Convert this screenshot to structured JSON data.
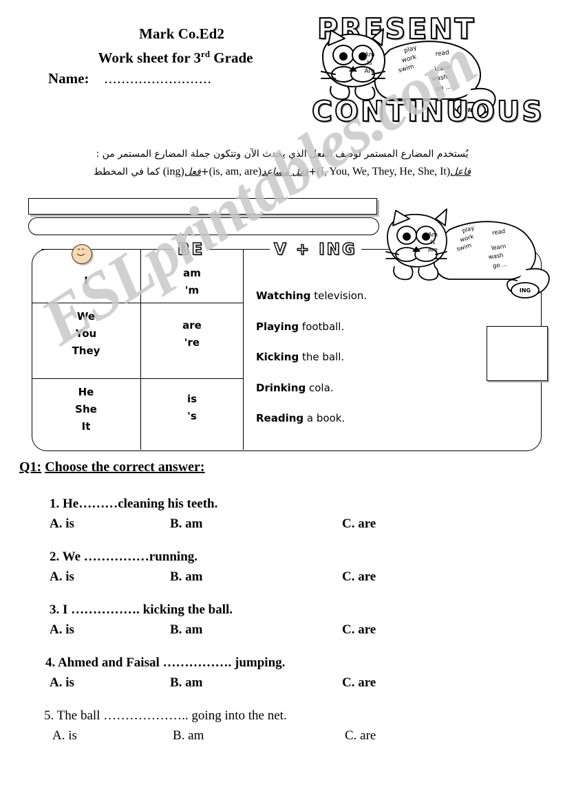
{
  "header": {
    "school": "Mark Co.Ed2",
    "worksheet_line_pre": "Work sheet for 3",
    "worksheet_line_sup": "rd",
    "worksheet_line_post": " Grade",
    "name_label": "Name:",
    "name_dots": "........................."
  },
  "title_art": {
    "word_top": "PRESENT",
    "word_bottom": "CONTINUOUS",
    "cat_head_words": "Am\nIs\nAre",
    "cat_body_words_1": "play",
    "cat_body_words_2": "work",
    "cat_body_words_3": "read",
    "cat_body_words_4": "swim",
    "cat_body_words_5": "learn",
    "cat_body_words_6": "wash",
    "cat_body_words_7": "go ...",
    "cat_tail_word": "ING"
  },
  "arabic": {
    "line1": "يُستخدم المضارع المستمر لوصف الفعل الذي يحدث الآن وتتكون جملة المضارع المستمر من :",
    "line2_a": "فاعل",
    "line2_en1": "(I, You, We, They, He, She, It)",
    "line2_b": "فعل مساعد",
    "line2_en2": "(is, am, are)",
    "line2_c": "فعل",
    "line2_en3": "(ing)",
    "line2_d": "كما في المخطط"
  },
  "table": {
    "head_be": "BE",
    "head_ving": "V + ING",
    "rows": [
      {
        "pronoun": "I",
        "be": "am\n'm"
      },
      {
        "pronoun": "We\nYou\nThey",
        "be": "are\n're"
      },
      {
        "pronoun": "He\nShe\nIt",
        "be": "is\n's"
      }
    ],
    "ving_items": [
      {
        "ing": "Watching",
        "rest": " television."
      },
      {
        "ing": "Playing",
        "rest": " football."
      },
      {
        "ing": "Kicking",
        "rest": " the ball."
      },
      {
        "ing": "Drinking",
        "rest": " cola."
      },
      {
        "ing": "Reading",
        "rest": " a book."
      }
    ]
  },
  "q1": {
    "label": "Q1:",
    "text": "Choose the correct answer:",
    "questions": [
      {
        "text": "1. He………cleaning his teeth.",
        "a": "A. is",
        "b": "B. am",
        "c": "C. are"
      },
      {
        "text": "2. We ……………running.",
        "a": "A. is",
        "b": "B. am",
        "c": "C. are"
      },
      {
        "text": "3. I ……………. kicking the ball.",
        "a": "A. is",
        "b": "B. am",
        "c": "C. are"
      },
      {
        "text": "4. Ahmed and Faisal ……………. jumping.",
        "a": "A. is",
        "b": "B. am",
        "c": "C. are"
      },
      {
        "text": "5. The ball ……………….. going into the net.",
        "a": "A. is",
        "b": "B. am",
        "c": "C. are"
      }
    ]
  },
  "watermark": {
    "text": "ESLprintables.com"
  },
  "colors": {
    "ink": "#000000",
    "paper": "#ffffff",
    "watermark": "#c8c8c8",
    "face": "#f6d9b0",
    "outline_shadow": "#9a9a9a"
  }
}
